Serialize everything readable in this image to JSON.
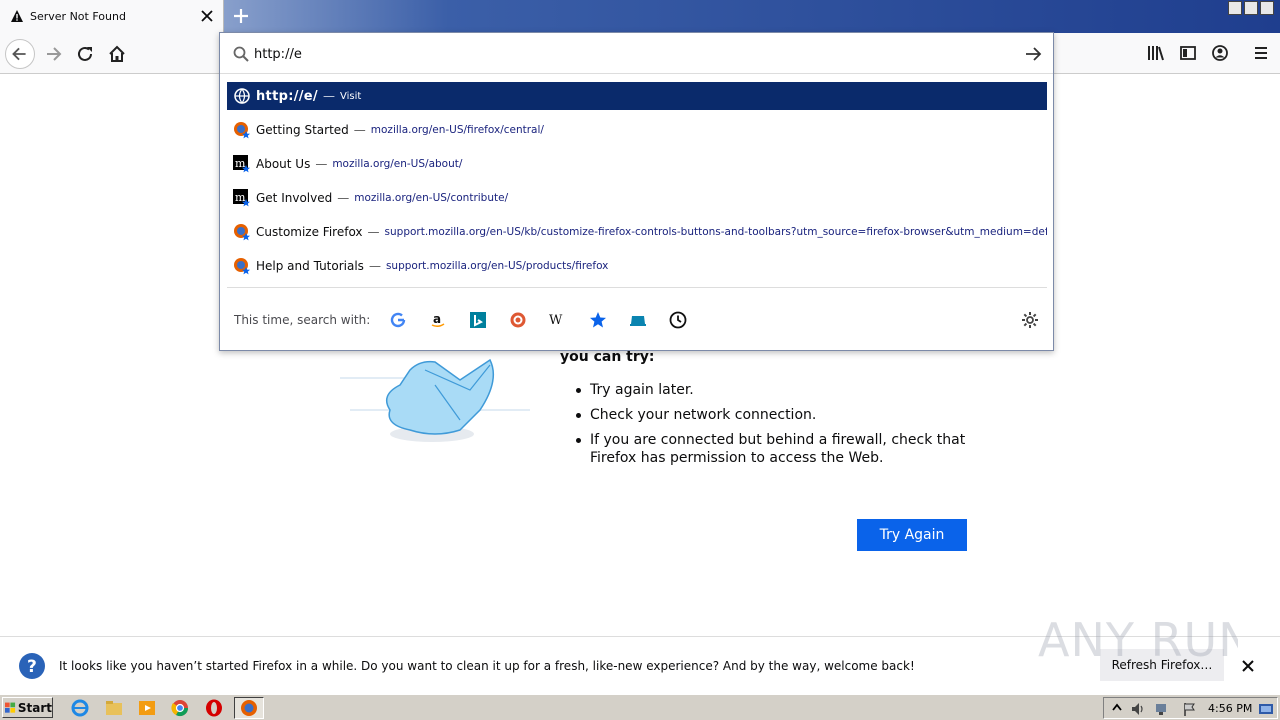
{
  "tab": {
    "title": "Server Not Found",
    "close_icon": "close-icon",
    "warning_icon": "warning-icon"
  },
  "url_bar": {
    "value": "http://e"
  },
  "suggestions": [
    {
      "title": "http://e/",
      "sep": "—",
      "url": "Visit",
      "icon": "globe-icon",
      "selected": true
    },
    {
      "title": "Getting Started",
      "sep": "—",
      "url": "mozilla.org/en-US/firefox/central/",
      "icon": "firefox-bookmark-icon"
    },
    {
      "title": "About Us",
      "sep": "—",
      "url": "mozilla.org/en-US/about/",
      "icon": "mozilla-bookmark-icon"
    },
    {
      "title": "Get Involved",
      "sep": "—",
      "url": "mozilla.org/en-US/contribute/",
      "icon": "mozilla-bookmark-icon"
    },
    {
      "title": "Customize Firefox",
      "sep": "—",
      "url": "support.mozilla.org/en-US/kb/customize-firefox-controls-buttons-and-toolbars?utm_source=firefox-browser&utm_medium=default-bookm",
      "icon": "firefox-bookmark-icon"
    },
    {
      "title": "Help and Tutorials",
      "sep": "—",
      "url": "support.mozilla.org/en-US/products/firefox",
      "icon": "firefox-bookmark-icon"
    }
  ],
  "search_with": {
    "label": "This time, search with:",
    "engines": [
      "google",
      "amazon",
      "bing",
      "duckduckgo",
      "wikipedia",
      "bookmarks",
      "tabs",
      "history"
    ]
  },
  "error_page": {
    "try_label": "you can try:",
    "tips": [
      "Try again later.",
      "Check your network connection.",
      "If you are connected but behind a firewall, check that Firefox has permission to access the Web."
    ],
    "try_again_button": "Try Again"
  },
  "notification": {
    "message": "It looks like you haven’t started Firefox in a while. Do you want to clean it up for a fresh, like-new experience? And by the way, welcome back!",
    "refresh_button": "Refresh Firefox…"
  },
  "watermark": {
    "text": "ANY RUN"
  },
  "taskbar": {
    "start_label": "Start",
    "clock": "4:56 PM"
  },
  "colors": {
    "selected_row": "#0a2a6b",
    "try_again": "#0a63ea",
    "url_text": "#1a237e"
  }
}
